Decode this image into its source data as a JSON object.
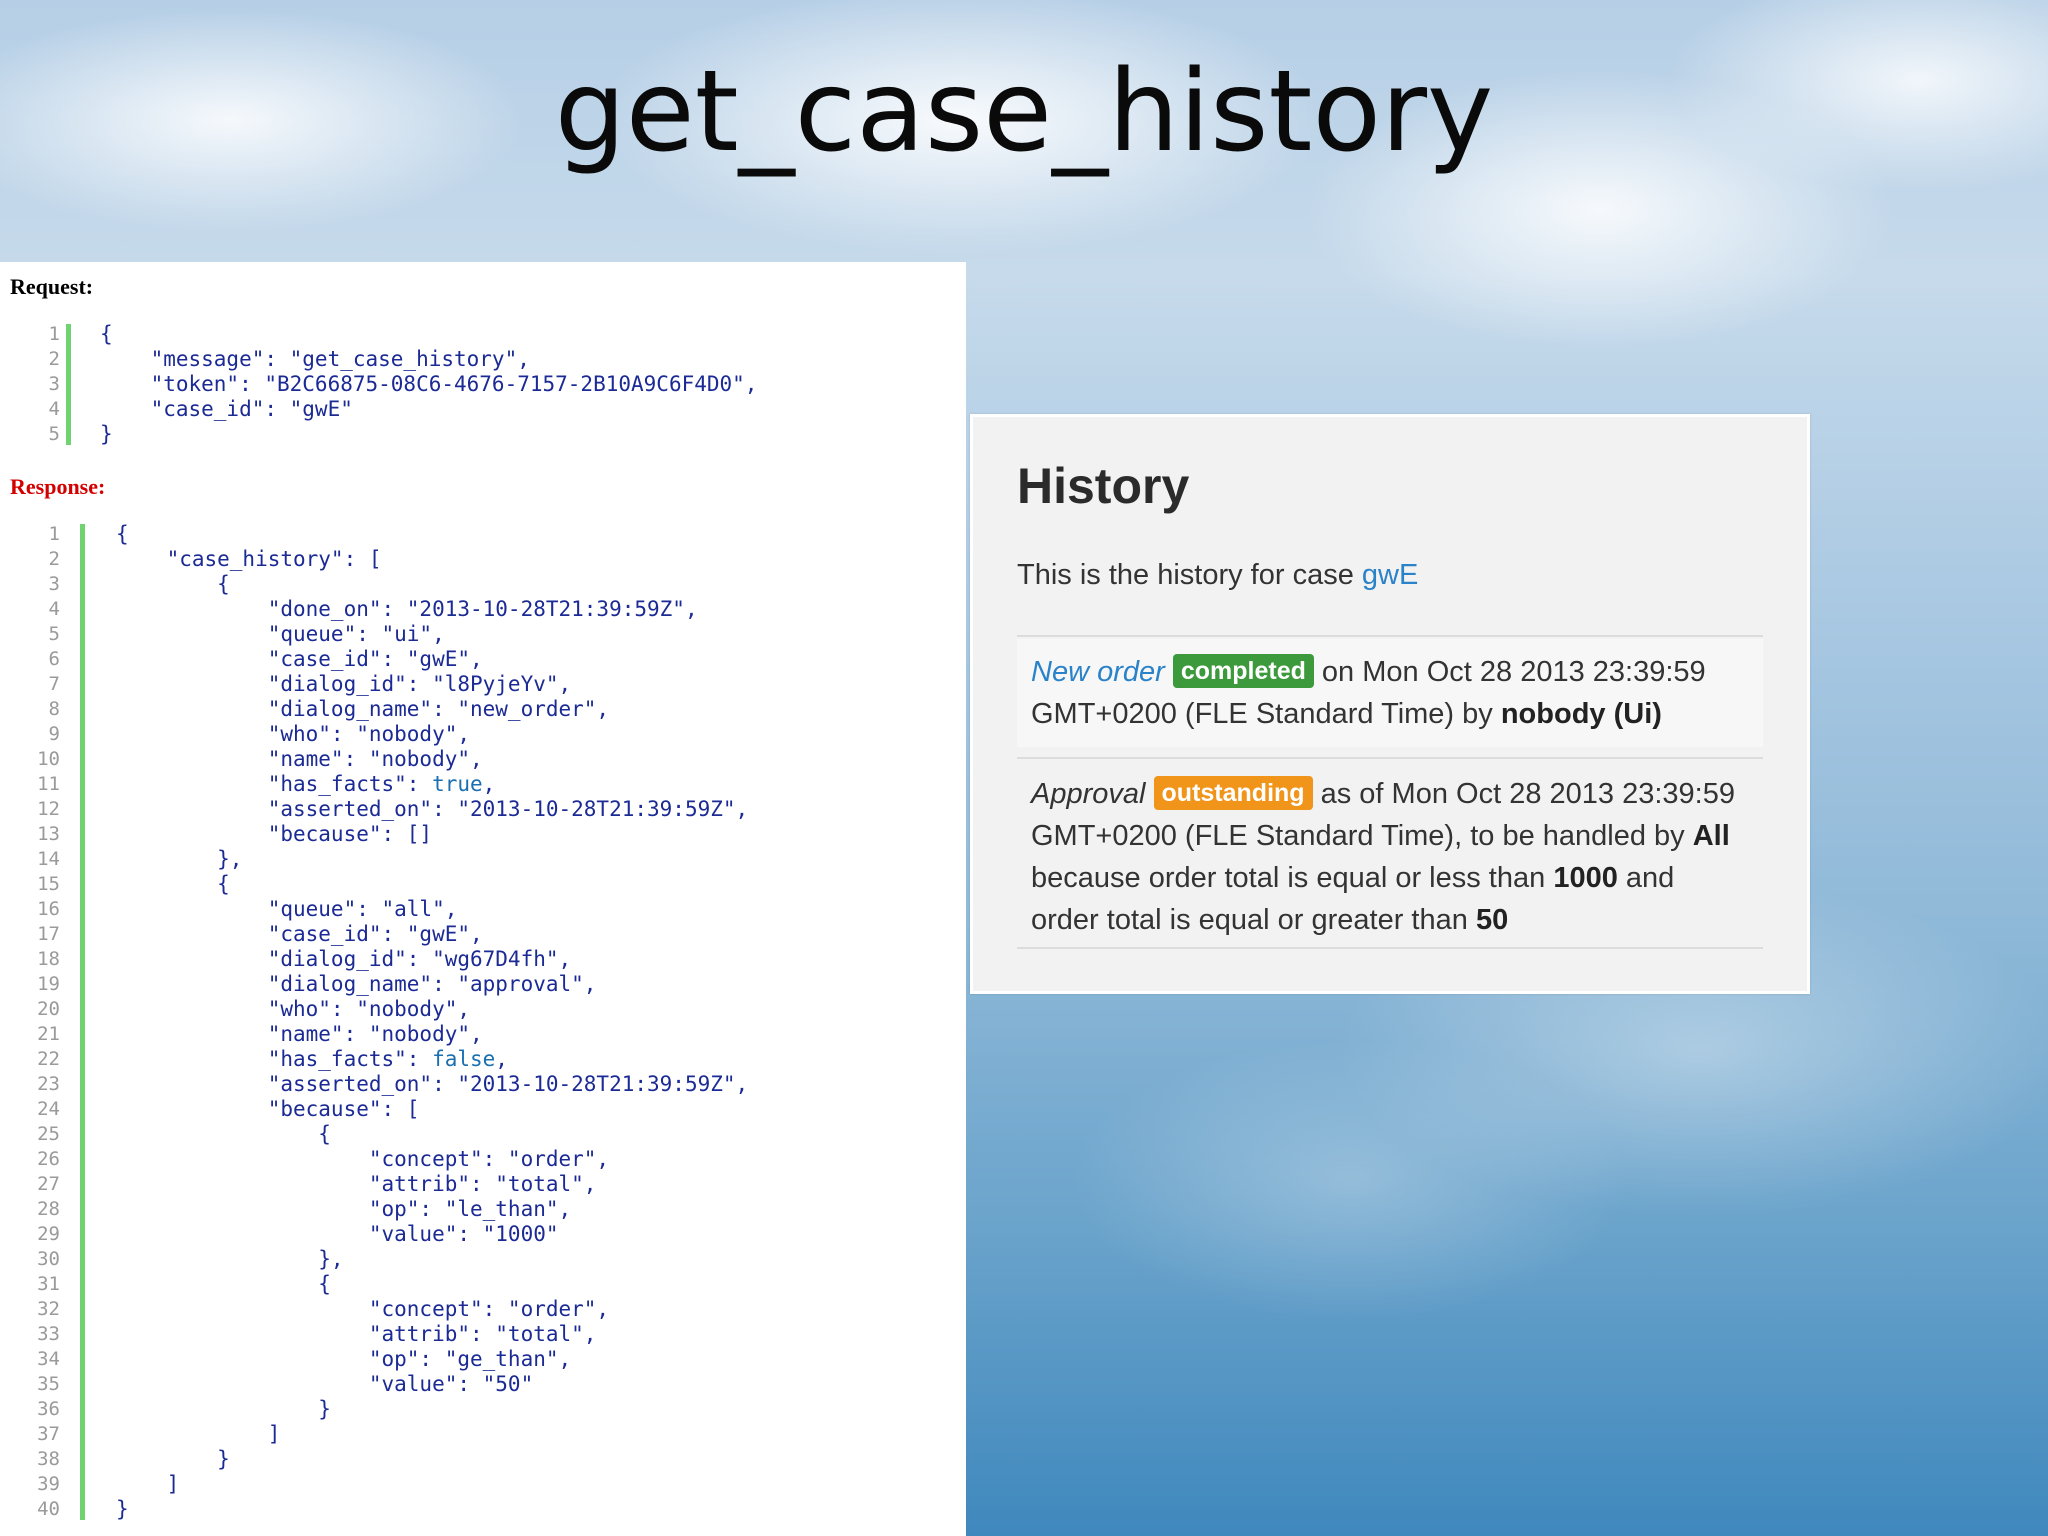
{
  "slide": {
    "title": "get_case_history"
  },
  "request": {
    "label": "Request:",
    "lines": [
      {
        "n": "1",
        "t": "{"
      },
      {
        "n": "2",
        "t": "    \"message\": \"get_case_history\","
      },
      {
        "n": "3",
        "t": "    \"token\": \"B2C66875-08C6-4676-7157-2B10A9C6F4D0\","
      },
      {
        "n": "4",
        "t": "    \"case_id\": \"gwE\""
      },
      {
        "n": "5",
        "t": "}"
      }
    ]
  },
  "response": {
    "label": "Response:",
    "lines": [
      {
        "n": "1",
        "t": "{"
      },
      {
        "n": "2",
        "t": "    \"case_history\": ["
      },
      {
        "n": "3",
        "t": "        {"
      },
      {
        "n": "4",
        "t": "            \"done_on\": \"2013-10-28T21:39:59Z\","
      },
      {
        "n": "5",
        "t": "            \"queue\": \"ui\","
      },
      {
        "n": "6",
        "t": "            \"case_id\": \"gwE\","
      },
      {
        "n": "7",
        "t": "            \"dialog_id\": \"l8PyjeYv\","
      },
      {
        "n": "8",
        "t": "            \"dialog_name\": \"new_order\","
      },
      {
        "n": "9",
        "t": "            \"who\": \"nobody\","
      },
      {
        "n": "10",
        "t": "            \"name\": \"nobody\","
      },
      {
        "n": "11",
        "t": "            \"has_facts\": true,"
      },
      {
        "n": "12",
        "t": "            \"asserted_on\": \"2013-10-28T21:39:59Z\","
      },
      {
        "n": "13",
        "t": "            \"because\": []"
      },
      {
        "n": "14",
        "t": "        },"
      },
      {
        "n": "15",
        "t": "        {"
      },
      {
        "n": "16",
        "t": "            \"queue\": \"all\","
      },
      {
        "n": "17",
        "t": "            \"case_id\": \"gwE\","
      },
      {
        "n": "18",
        "t": "            \"dialog_id\": \"wg67D4fh\","
      },
      {
        "n": "19",
        "t": "            \"dialog_name\": \"approval\","
      },
      {
        "n": "20",
        "t": "            \"who\": \"nobody\","
      },
      {
        "n": "21",
        "t": "            \"name\": \"nobody\","
      },
      {
        "n": "22",
        "t": "            \"has_facts\": false,"
      },
      {
        "n": "23",
        "t": "            \"asserted_on\": \"2013-10-28T21:39:59Z\","
      },
      {
        "n": "24",
        "t": "            \"because\": ["
      },
      {
        "n": "25",
        "t": "                {"
      },
      {
        "n": "26",
        "t": "                    \"concept\": \"order\","
      },
      {
        "n": "27",
        "t": "                    \"attrib\": \"total\","
      },
      {
        "n": "28",
        "t": "                    \"op\": \"le_than\","
      },
      {
        "n": "29",
        "t": "                    \"value\": \"1000\""
      },
      {
        "n": "30",
        "t": "                },"
      },
      {
        "n": "31",
        "t": "                {"
      },
      {
        "n": "32",
        "t": "                    \"concept\": \"order\","
      },
      {
        "n": "33",
        "t": "                    \"attrib\": \"total\","
      },
      {
        "n": "34",
        "t": "                    \"op\": \"ge_than\","
      },
      {
        "n": "35",
        "t": "                    \"value\": \"50\""
      },
      {
        "n": "36",
        "t": "                }"
      },
      {
        "n": "37",
        "t": "            ]"
      },
      {
        "n": "38",
        "t": "        }"
      },
      {
        "n": "39",
        "t": "    ]"
      },
      {
        "n": "40",
        "t": "}"
      }
    ]
  },
  "history": {
    "heading": "History",
    "intro_prefix": "This is the history for case ",
    "case_link": "gwE",
    "entry1": {
      "step": "New order",
      "badge": "completed",
      "text_a": " on Mon Oct 28 2013 23:39:59 GMT+0200 (FLE Standard Time) by ",
      "who": "nobody (Ui)"
    },
    "entry2": {
      "step": "Approval",
      "badge": "outstanding",
      "text_a": " as of Mon Oct 28 2013 23:39:59 GMT+0200 (FLE Standard Time), to be handled by ",
      "queue": "All",
      "text_b": " because order total is equal or less than ",
      "v1": "1000",
      "text_c": " and order total is equal or greater than ",
      "v2": "50"
    }
  },
  "colors": {
    "gutter_green": "#6fd36f",
    "response_label_red": "#d40000",
    "json_key_blue": "#1b2a94",
    "link_blue": "#2a82c9",
    "badge_completed": "#3c9a3c",
    "badge_outstanding": "#f0941a"
  }
}
